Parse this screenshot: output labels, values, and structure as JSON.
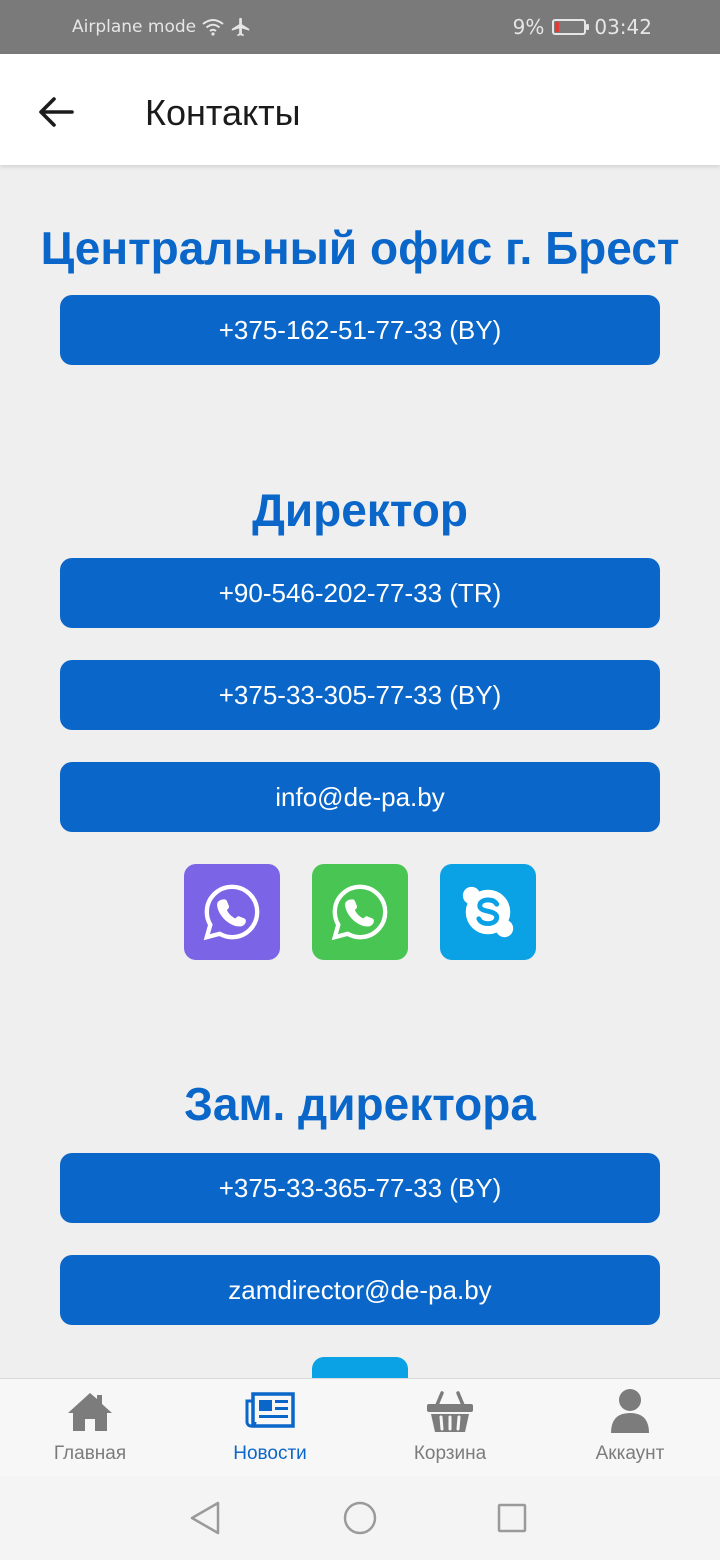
{
  "status_bar": {
    "airplane_label": "Airplane mode",
    "battery": "9%",
    "time": "03:42",
    "icons": [
      "wifi-icon",
      "airplane-icon",
      "battery-icon"
    ],
    "battery_level": 0.09
  },
  "header": {
    "title": "Контакты",
    "back_icon": "arrow-left-icon"
  },
  "sections": [
    {
      "title": "Центральный офис г. Брест",
      "buttons": [
        "+375-162-51-77-33 (BY)"
      ]
    },
    {
      "title": "Директор",
      "buttons": [
        "+90-546-202-77-33 (TR)",
        "+375-33-305-77-33 (BY)",
        "info@de-pa.by"
      ],
      "messengers": [
        "viber-icon",
        "whatsapp-icon",
        "skype-icon"
      ]
    },
    {
      "title": "Зам. директора",
      "buttons": [
        "+375-33-365-77-33 (BY)",
        "zamdirector@de-pa.by"
      ]
    }
  ],
  "bottom_nav": [
    {
      "label": "Главная",
      "icon": "home-icon",
      "active": false
    },
    {
      "label": "Новости",
      "icon": "newspaper-icon",
      "active": true
    },
    {
      "label": "Корзина",
      "icon": "basket-icon",
      "active": false
    },
    {
      "label": "Аккаунт",
      "icon": "user-icon",
      "active": false
    }
  ],
  "colors": {
    "primary": "#0a66c8",
    "viber": "#7c64e6",
    "whatsapp": "#48c553",
    "skype": "#0aa2e4",
    "background": "#efefef"
  }
}
